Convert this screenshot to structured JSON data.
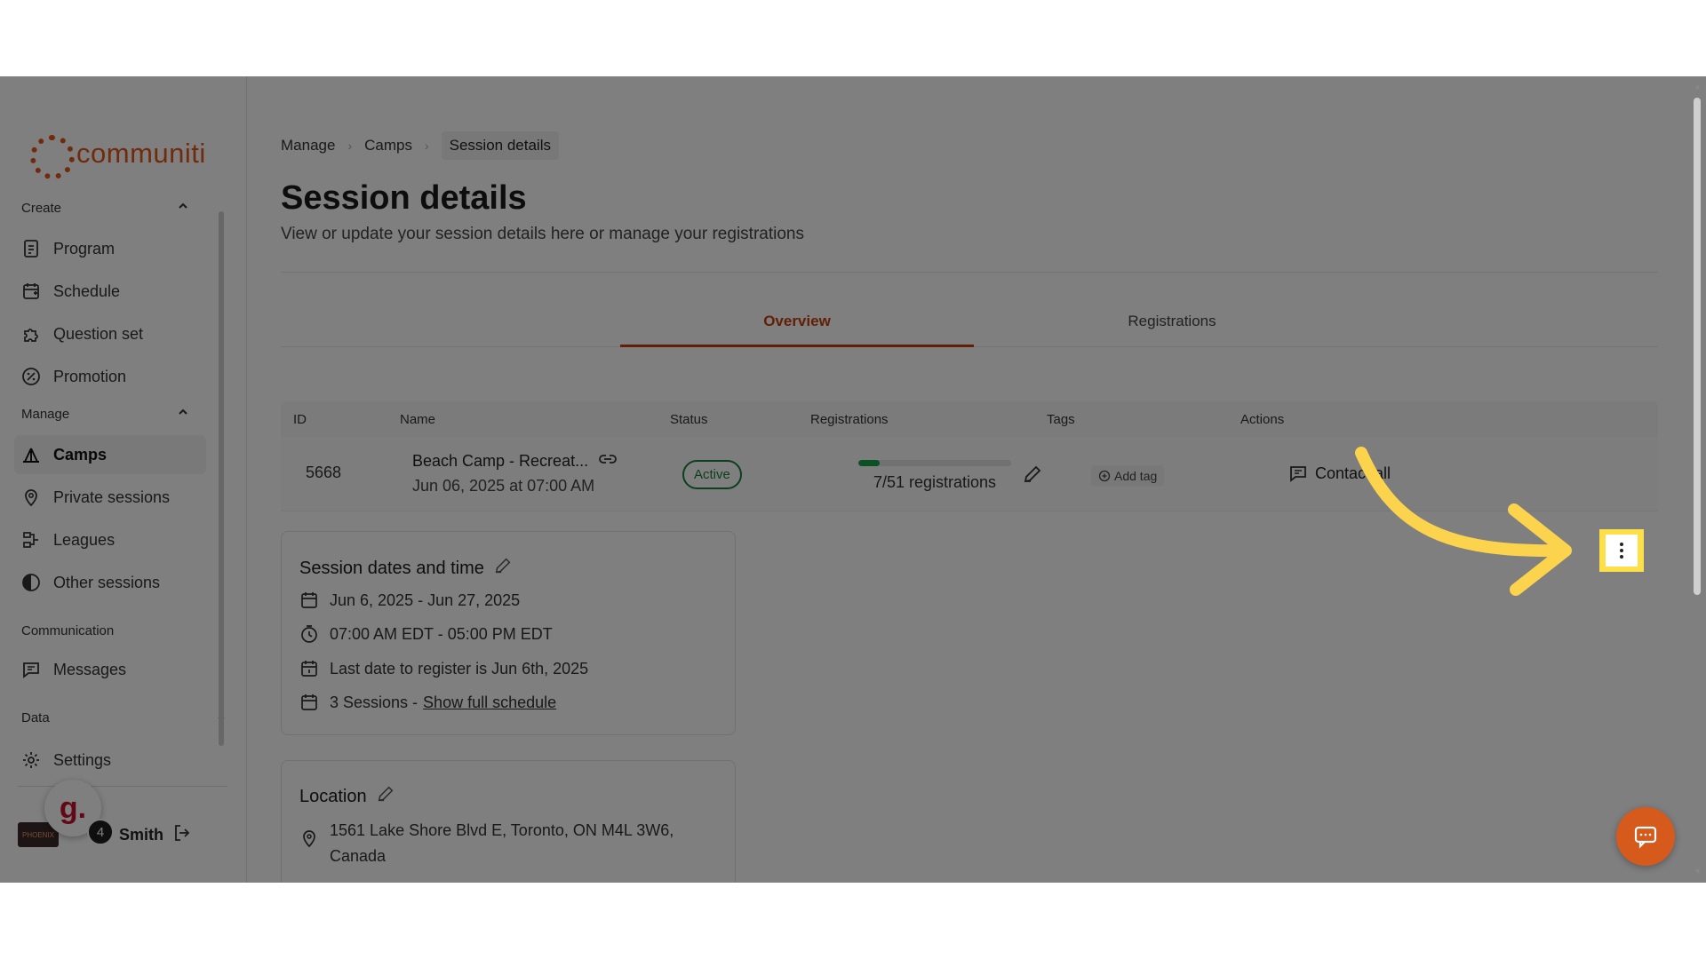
{
  "brand": {
    "name": "communiti",
    "color": "#e0561b"
  },
  "sidebar": {
    "create_label": "Create",
    "create_items": [
      {
        "label": "Program",
        "icon": "document-icon"
      },
      {
        "label": "Schedule",
        "icon": "calendar-plus-icon"
      },
      {
        "label": "Question set",
        "icon": "puzzle-icon"
      },
      {
        "label": "Promotion",
        "icon": "percent-icon"
      }
    ],
    "manage_label": "Manage",
    "manage_items": [
      {
        "label": "Camps",
        "icon": "tent-icon",
        "active": true
      },
      {
        "label": "Private sessions",
        "icon": "person-pin-icon"
      },
      {
        "label": "Leagues",
        "icon": "bracket-icon"
      },
      {
        "label": "Other sessions",
        "icon": "half-circle-icon"
      }
    ],
    "communication_label": "Communication",
    "messages_label": "Messages",
    "data_label": "Data",
    "settings_label": "Settings",
    "user": {
      "name": "Smith",
      "avatar_text": "PHOENIX"
    },
    "g_badge_letter": "g.",
    "g_badge_count": "4"
  },
  "breadcrumb": {
    "items": [
      "Manage",
      "Camps"
    ],
    "current": "Session details"
  },
  "page": {
    "title": "Session details",
    "subtitle": "View or update your session details here or manage your registrations"
  },
  "tabs": [
    {
      "label": "Overview",
      "active": true
    },
    {
      "label": "Registrations",
      "active": false
    }
  ],
  "table": {
    "headers": [
      "ID",
      "Name",
      "Status",
      "Registrations",
      "Tags",
      "Actions"
    ],
    "row": {
      "id": "5668",
      "name": "Beach Camp - Recreat...",
      "date": "Jun 06, 2025 at 07:00 AM",
      "status": "Active",
      "registrations_text": "7/51 registrations",
      "registrations_fraction": 0.137,
      "add_tag": "Add tag",
      "contact": "Contact all"
    }
  },
  "dates_card": {
    "title": "Session dates and time",
    "range": "Jun 6, 2025 - Jun 27, 2025",
    "time": "07:00 AM EDT - 05:00 PM EDT",
    "last_date": "Last date to register is Jun 6th, 2025",
    "sessions": "3 Sessions -",
    "schedule_link": "Show full schedule"
  },
  "location_card": {
    "title": "Location",
    "address_line1": "1561 Lake Shore Blvd E, Toronto, ON M4L 3W6,",
    "address_line2": "Canada"
  },
  "colors": {
    "accent": "#c2410c",
    "active_green": "#15803d",
    "highlight": "#fde047",
    "annotation_arrow": "#fcd34d"
  }
}
